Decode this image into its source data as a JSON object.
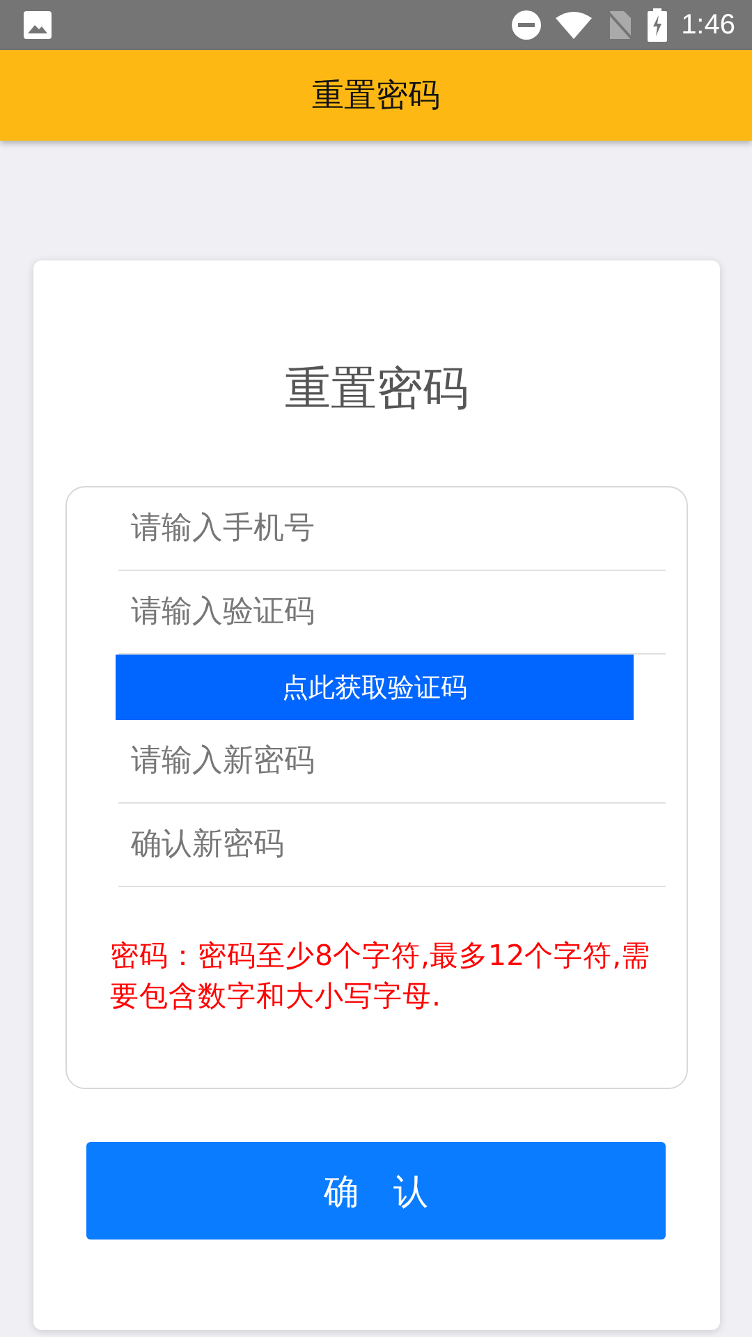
{
  "status_bar": {
    "time": "1:46"
  },
  "app_bar": {
    "title": "重置密码"
  },
  "card": {
    "title": "重置密码",
    "rows": [
      {
        "kind": "field",
        "placeholder": "请输入手机号"
      },
      {
        "kind": "field",
        "placeholder": "请输入验证码"
      },
      {
        "kind": "button",
        "label": "点此获取验证码"
      },
      {
        "kind": "field",
        "placeholder": "请输入新密码"
      },
      {
        "kind": "field",
        "placeholder": "确认新密码"
      }
    ],
    "note": "密码：密码至少8个字符,最多12个字符,需要包含数字和大小写字母.",
    "confirm_button": "确　认"
  }
}
